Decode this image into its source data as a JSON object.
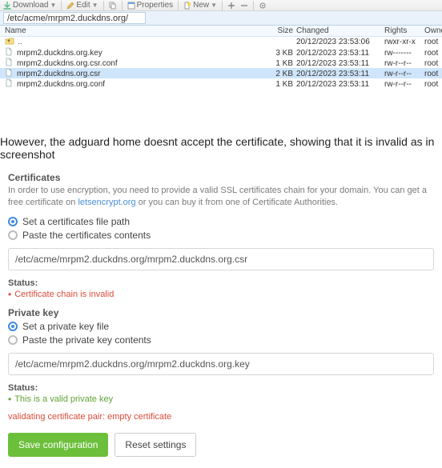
{
  "toolbar": {
    "download_label": "Download",
    "edit_label": "Edit",
    "duplicate_tip": "",
    "properties_label": "Properties",
    "new_label": "New"
  },
  "pathbar": {
    "path": "/etc/acme/mrpm2.duckdns.org/"
  },
  "file_header": {
    "name": "Name",
    "size": "Size",
    "changed": "Changed",
    "rights": "Rights",
    "owner": "Owner"
  },
  "files": [
    {
      "kind": "updir",
      "name": "..",
      "size": "",
      "changed": "20/12/2023 23:53:06",
      "rights": "rwxr-xr-x",
      "owner": "root"
    },
    {
      "kind": "file",
      "name": "mrpm2.duckdns.org.key",
      "size": "3 KB",
      "changed": "20/12/2023 23:53:11",
      "rights": "rw-------",
      "owner": "root"
    },
    {
      "kind": "file",
      "name": "mrpm2.duckdns.org.csr.conf",
      "size": "1 KB",
      "changed": "20/12/2023 23:53:11",
      "rights": "rw-r--r--",
      "owner": "root"
    },
    {
      "kind": "file",
      "name": "mrpm2.duckdns.org.csr",
      "size": "2 KB",
      "changed": "20/12/2023 23:53:11",
      "rights": "rw-r--r--",
      "owner": "root",
      "selected": true
    },
    {
      "kind": "file",
      "name": "mrpm2.duckdns.org.conf",
      "size": "1 KB",
      "changed": "20/12/2023 23:53:11",
      "rights": "rw-r--r--",
      "owner": "root"
    }
  ],
  "mid_paragraph": "However, the adguard home doesnt accept the certificate, showing that it is invalid as in screenshot",
  "cert_section": {
    "heading": "Certificates",
    "desc_pre": "In order to use encryption, you need to provide a valid SSL certificates chain for your domain. You can get a free certificate on ",
    "desc_link": "letsencrypt.org",
    "desc_post": " or you can buy it from one of Certificate Authorities.",
    "radio_path": "Set a certificates file path",
    "radio_paste": "Paste the certificates contents",
    "path_value": "/etc/acme/mrpm2.duckdns.org/mrpm2.duckdns.org.csr",
    "status_label": "Status:",
    "status_msg": "Certificate chain is invalid"
  },
  "key_section": {
    "heading": "Private key",
    "radio_file": "Set a private key file",
    "radio_paste": "Paste the private key contents",
    "path_value": "/etc/acme/mrpm2.duckdns.org/mrpm2.duckdns.org.key",
    "status_label": "Status:",
    "status_msg": "This is a valid private key"
  },
  "validating_msg": "validating certificate pair: empty certificate",
  "buttons": {
    "save": "Save configuration",
    "reset": "Reset settings"
  }
}
